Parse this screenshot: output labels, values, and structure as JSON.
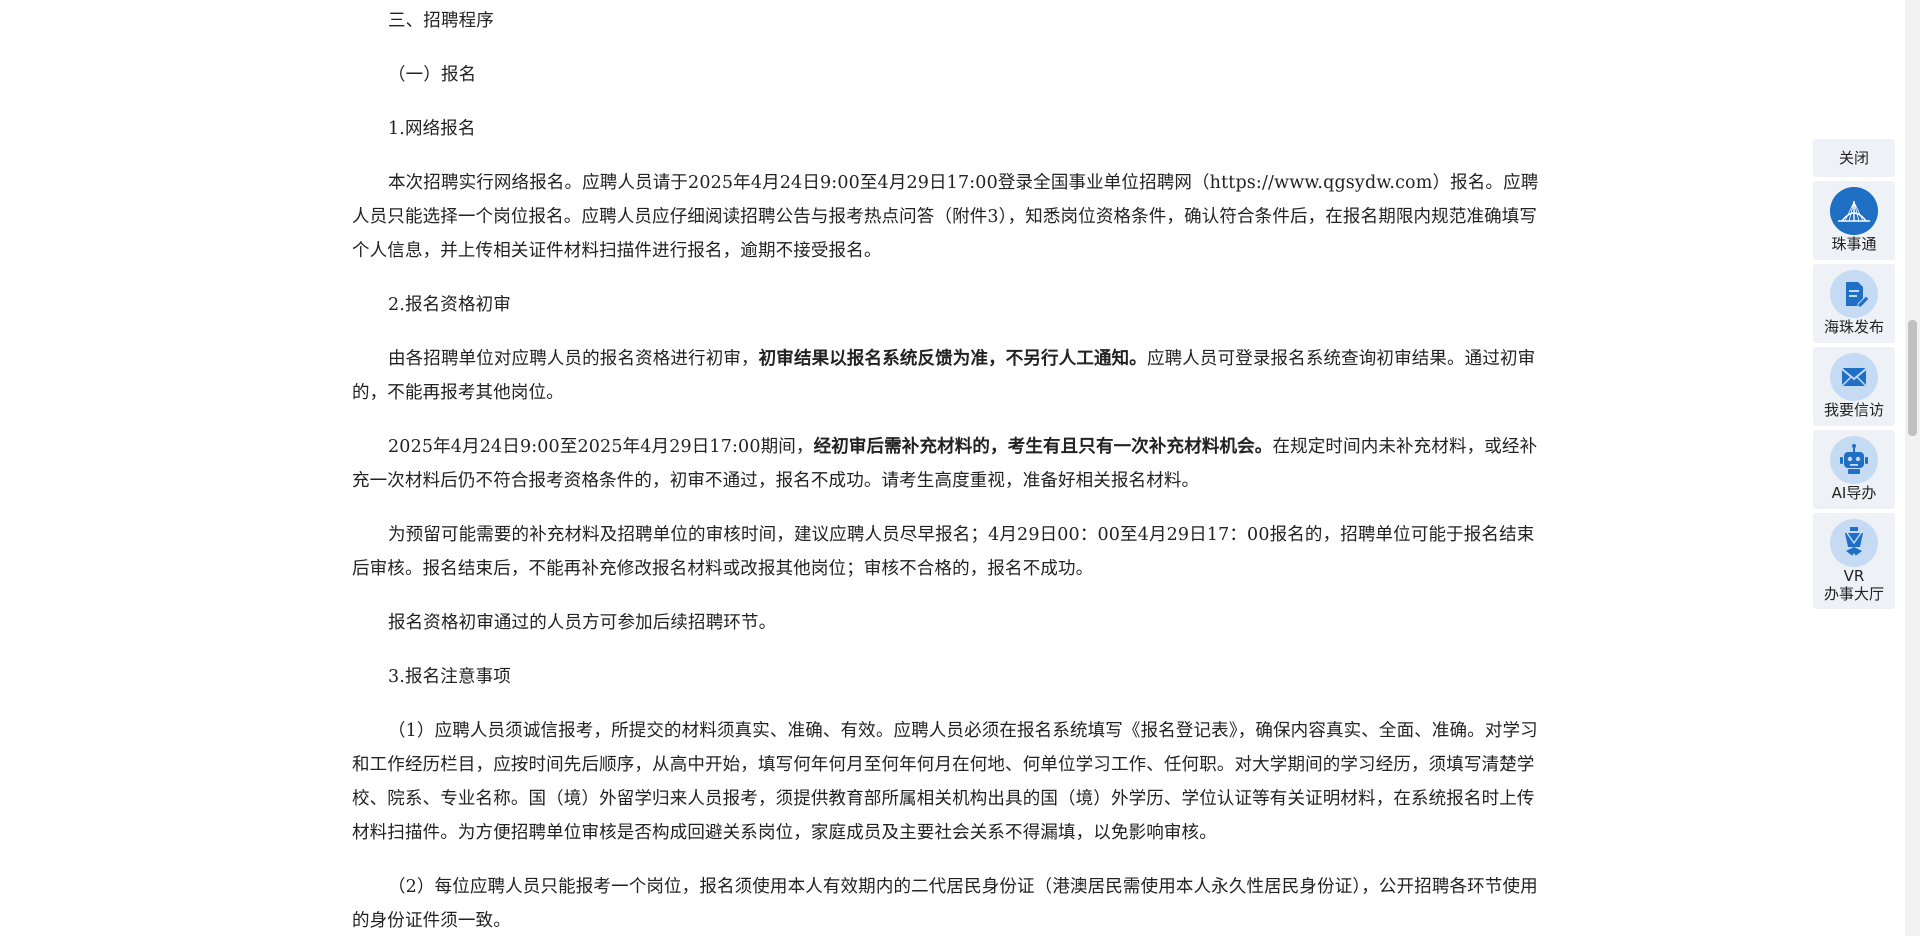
{
  "article": {
    "h_section": "三、招聘程序",
    "h_sub1": "（一）报名",
    "h_online": "1.网络报名",
    "p_online": "本次招聘实行网络报名。应聘人员请于2025年4月24日9:00至4月29日17:00登录全国事业单位招聘网（https://www.qgsydw.com）报名。应聘人员只能选择一个岗位报名。应聘人员应仔细阅读招聘公告与报考热点问答（附件3），知悉岗位资格条件，确认符合条件后，在报名期限内规范准确填写个人信息，并上传相关证件材料扫描件进行报名，逾期不接受报名。",
    "h_review": "2.报名资格初审",
    "p_review_a": "由各招聘单位对应聘人员的报名资格进行初审，",
    "p_review_b": "初审结果以报名系统反馈为准，不另行人工通知。",
    "p_review_c": "应聘人员可登录报名系统查询初审结果。通过初审的，不能再报考其他岗位。",
    "p_supp_a": "2025年4月24日9:00至2025年4月29日17:00期间，",
    "p_supp_b": "经初审后需补充材料的，考生有且只有一次补充材料机会。",
    "p_supp_c": "在规定时间内未补充材料，或经补充一次材料后仍不符合报考资格条件的，初审不通过，报名不成功。请考生高度重视，准备好相关报名材料。",
    "p_reserve": "为预留可能需要的补充材料及招聘单位的审核时间，建议应聘人员尽早报名；4月29日00：00至4月29日17：00报名的，招聘单位可能于报名结束后审核。报名结束后，不能再补充修改报名材料或改报其他岗位；审核不合格的，报名不成功。",
    "p_pass": "报名资格初审通过的人员方可参加后续招聘环节。",
    "h_notes": "3.报名注意事项",
    "p_note1": "（1）应聘人员须诚信报考，所提交的材料须真实、准确、有效。应聘人员必须在报名系统填写《报名登记表》，确保内容真实、全面、准确。对学习和工作经历栏目，应按时间先后顺序，从高中开始，填写何年何月至何年何月在何地、何单位学习工作、任何职。对大学期间的学习经历，须填写清楚学校、院系、专业名称。国（境）外留学归来人员报考，须提供教育部所属相关机构出具的国（境）外学历、学位认证等有关证明材料，在系统报名时上传材料扫描件。为方便招聘单位审核是否构成回避关系岗位，家庭成员及主要社会关系不得漏填，以免影响审核。",
    "p_note2": "（2）每位应聘人员只能报考一个岗位，报名须使用本人有效期内的二代居民身份证（港澳居民需使用本人永久性居民身份证），公开招聘各环节使用的身份证件须一致。"
  },
  "toolbar": {
    "close_label": "关闭",
    "items": [
      {
        "label": "珠事通",
        "icon": "bridge-icon"
      },
      {
        "label": "海珠发布",
        "icon": "document-edit-icon"
      },
      {
        "label": "我要信访",
        "icon": "mail-icon"
      },
      {
        "label": "AI导办",
        "icon": "robot-icon"
      },
      {
        "label_line1": "VR",
        "label_line2": "办事大厅",
        "icon": "vr-hall-icon"
      }
    ]
  },
  "colors": {
    "text": "#222222",
    "toolbar_bg": "#eef1f5",
    "icon_circle": "#c5daf3",
    "icon_blue": "#1f6fc4"
  }
}
